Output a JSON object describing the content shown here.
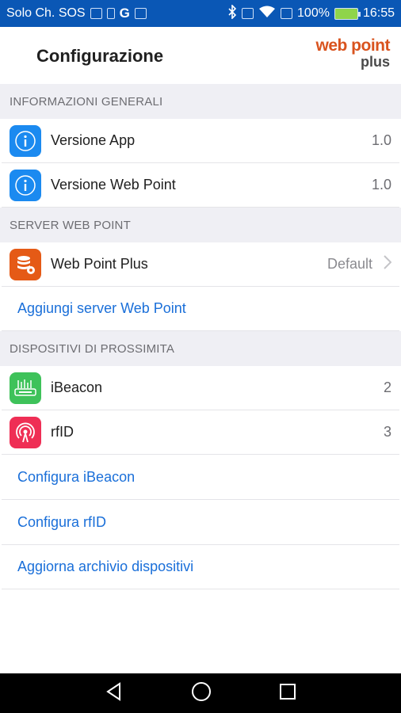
{
  "status_bar": {
    "carrier": "Solo Ch. SOS",
    "google_letter": "G",
    "battery_percent": "100%",
    "time": "16:55"
  },
  "header": {
    "title": "Configurazione",
    "logo_line1": "web point",
    "logo_line2": "plus"
  },
  "sections": {
    "general": {
      "title": "INFORMAZIONI GENERALI",
      "items": [
        {
          "label": "Versione App",
          "value": "1.0"
        },
        {
          "label": "Versione Web Point",
          "value": "1.0"
        }
      ]
    },
    "server": {
      "title": "SERVER WEB POINT",
      "item": {
        "label": "Web Point Plus",
        "value": "Default"
      },
      "add_link": "Aggiungi server Web Point"
    },
    "devices": {
      "title": "DISPOSITIVI DI PROSSIMITA",
      "items": [
        {
          "label": "iBeacon",
          "value": "2"
        },
        {
          "label": "rfID",
          "value": "3"
        }
      ],
      "links": [
        "Configura iBeacon",
        "Configura rfID",
        "Aggiorna archivio dispositivi"
      ]
    }
  },
  "colors": {
    "status_bar": "#0a57b5",
    "link": "#1a6fd9",
    "section_bg": "#efeff4",
    "info_icon": "#1b8af0",
    "server_icon": "#e55a16",
    "beacon_icon": "#3ec25a",
    "rfid_icon": "#ef2e55"
  },
  "icons": {
    "info": "info-icon",
    "server": "database-icon",
    "ibeacon": "beacon-icon",
    "rfid": "rfid-icon",
    "chevron": "chevron-right-icon",
    "nav_back": "back-triangle-icon",
    "nav_home": "home-circle-icon",
    "nav_recent": "recent-apps-square-icon"
  }
}
